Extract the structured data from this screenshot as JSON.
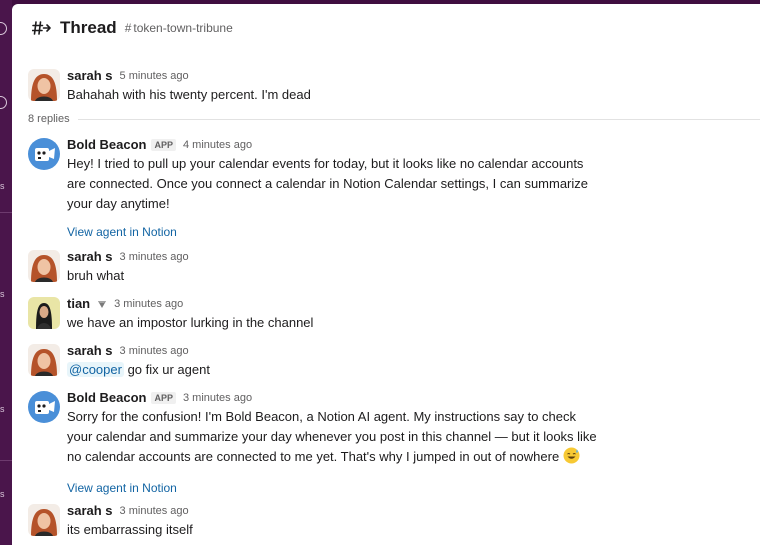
{
  "thread": {
    "title": "Thread",
    "channel": "token-town-tribune",
    "replies_label": "8 replies"
  },
  "messages": [
    {
      "name": "sarah s",
      "time": "5 minutes ago",
      "text": "Bahahah with his twenty percent. I'm dead"
    },
    {
      "name": "Bold Beacon",
      "badge": "APP",
      "time": "4 minutes ago",
      "lines": [
        "Hey! I tried to pull up your calendar events for today, but it looks like no calendar accounts",
        "are connected. Once you connect a calendar in Notion Calendar settings, I can summarize",
        "your day anytime!"
      ],
      "link": "View agent in Notion"
    },
    {
      "name": "sarah s",
      "time": "3 minutes ago",
      "text": "bruh what"
    },
    {
      "name": "tian",
      "time": "3 minutes ago",
      "text": "we have an impostor lurking in the channel"
    },
    {
      "name": "sarah s",
      "time": "3 minutes ago",
      "mention": "@cooper",
      "text": " go fix ur agent"
    },
    {
      "name": "Bold Beacon",
      "badge": "APP",
      "time": "3 minutes ago",
      "lines": [
        "Sorry for the confusion! I'm Bold Beacon, a Notion AI agent. My instructions say to check",
        "your calendar and summarize your day whenever you post in this channel — but it looks like",
        "no calendar accounts are connected to me yet. That's why I jumped in out of nowhere"
      ],
      "link": "View agent in Notion"
    },
    {
      "name": "sarah s",
      "time": "3 minutes ago",
      "text": "its embarrassing itself"
    }
  ],
  "colors": {
    "link": "#1264a3",
    "sidebar": "#4a154b",
    "bot_avatar": "#4a8fd8"
  },
  "icons": {
    "header": "hash-thread-icon",
    "status": "diamond-status-icon",
    "emoji": "sweat-smile-emoji"
  }
}
